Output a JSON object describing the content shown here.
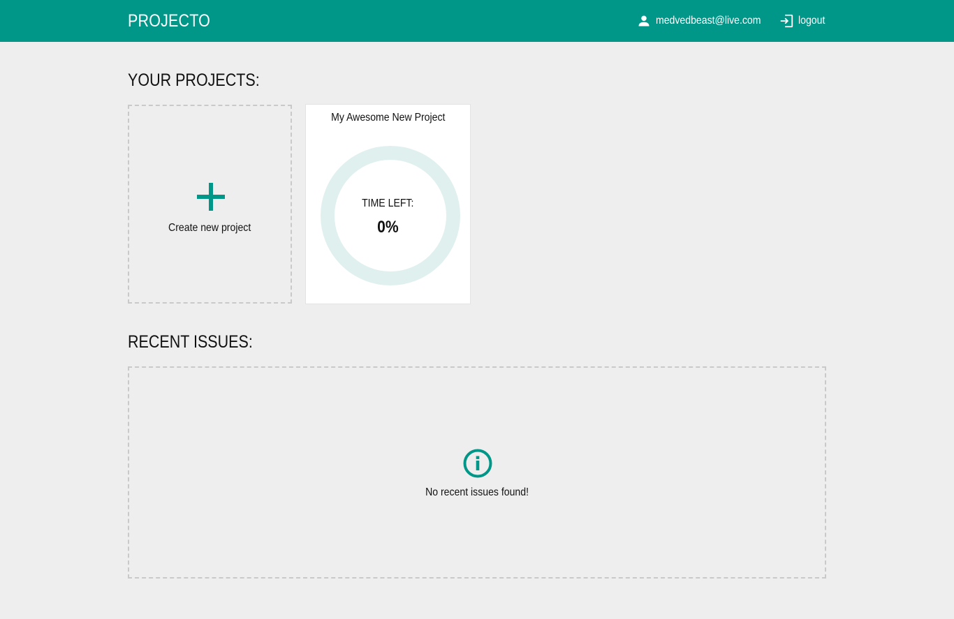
{
  "header": {
    "brand": "PROJECTO",
    "user_email": "medvedbeast@live.com",
    "logout_label": "logout",
    "user_icon": "person-icon",
    "logout_icon": "logout-icon",
    "accent_color": "#009688"
  },
  "projects": {
    "title": "YOUR PROJECTS:",
    "create_label": "Create new project",
    "create_icon": "plus-icon",
    "items": [
      {
        "name": "My Awesome New Project",
        "time_left_label": "TIME LEFT:",
        "time_left_value": "0%",
        "time_left_fraction": 0
      }
    ]
  },
  "issues": {
    "title": "RECENT ISSUES:",
    "empty_icon": "info-icon",
    "empty_text": "No recent issues found!"
  }
}
